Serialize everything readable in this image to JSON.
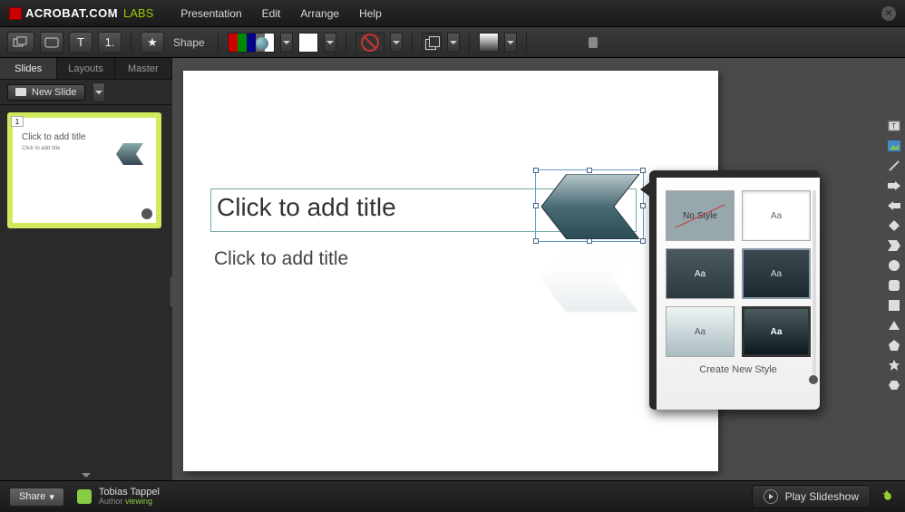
{
  "app": {
    "name": "ACROBAT.COM",
    "suffix": "LABS"
  },
  "menu": {
    "presentation": "Presentation",
    "edit": "Edit",
    "arrange": "Arrange",
    "help": "Help"
  },
  "toolbar": {
    "text_tool": "T",
    "list_tool": "1.",
    "star_tool": "★",
    "shape_label": "Shape"
  },
  "panel": {
    "tabs": {
      "slides": "Slides",
      "layouts": "Layouts",
      "master": "Master"
    },
    "new_slide": "New Slide",
    "thumb": {
      "num": "1",
      "title": "Click to add title",
      "subtitle": "Click to add title"
    }
  },
  "slide": {
    "title_placeholder": "Click to add title",
    "subtitle_placeholder": "Click to add title"
  },
  "style_popup": {
    "no_style": "No Style",
    "aa": "Aa",
    "create": "Create New Style"
  },
  "bottom": {
    "share": "Share",
    "user_name": "Tobias Tappel",
    "author_label": "Author",
    "status": "viewing",
    "play": "Play Slideshow"
  }
}
